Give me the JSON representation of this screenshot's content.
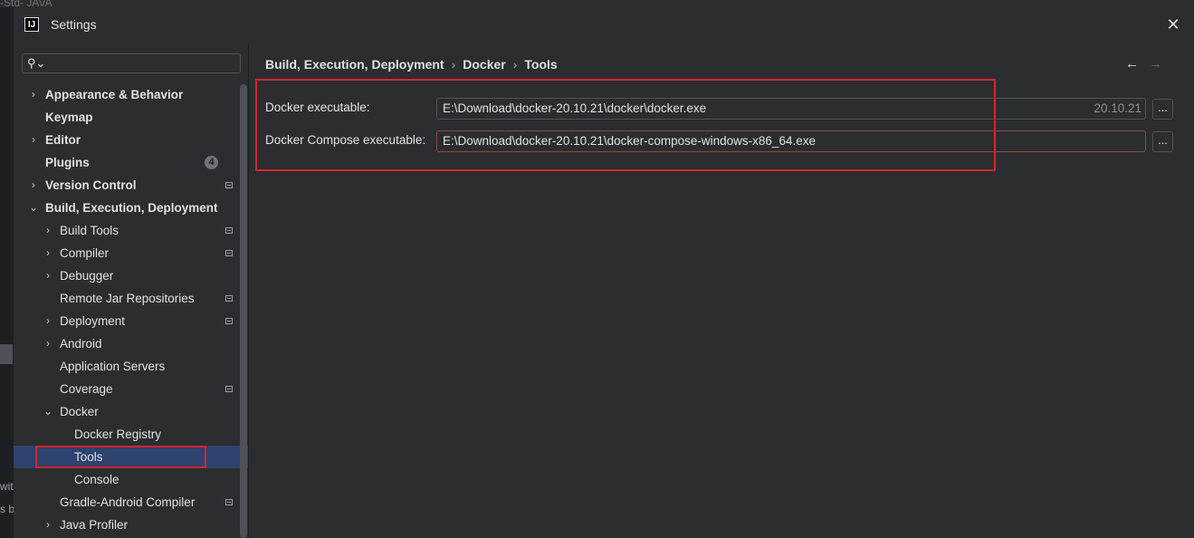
{
  "background": {
    "ide_text": "-Std- JAVA",
    "left_text_1": "wit",
    "left_text_2": "s b"
  },
  "dialog": {
    "title": "Settings",
    "app_icon": "IJ",
    "close_icon": "close-icon"
  },
  "sidebar": {
    "search_placeholder": "",
    "items": [
      {
        "label": "Appearance & Behavior",
        "chevron": "›",
        "bold": true,
        "badge": "",
        "mark": false
      },
      {
        "label": "Keymap",
        "chevron": "",
        "bold": true,
        "badge": "",
        "mark": false
      },
      {
        "label": "Editor",
        "chevron": "›",
        "bold": true,
        "badge": "",
        "mark": false
      },
      {
        "label": "Plugins",
        "chevron": "",
        "bold": true,
        "badge": "4",
        "mark": false
      },
      {
        "label": "Version Control",
        "chevron": "›",
        "bold": true,
        "badge": "",
        "mark": true
      },
      {
        "label": "Build, Execution, Deployment",
        "chevron": "⌄",
        "bold": true,
        "badge": "",
        "mark": false
      },
      {
        "label": "Build Tools",
        "chevron": "›",
        "bold": false,
        "badge": "",
        "mark": true
      },
      {
        "label": "Compiler",
        "chevron": "›",
        "bold": false,
        "badge": "",
        "mark": true
      },
      {
        "label": "Debugger",
        "chevron": "›",
        "bold": false,
        "badge": "",
        "mark": false
      },
      {
        "label": "Remote Jar Repositories",
        "chevron": "",
        "bold": false,
        "badge": "",
        "mark": true
      },
      {
        "label": "Deployment",
        "chevron": "›",
        "bold": false,
        "badge": "",
        "mark": true
      },
      {
        "label": "Android",
        "chevron": "›",
        "bold": false,
        "badge": "",
        "mark": false
      },
      {
        "label": "Application Servers",
        "chevron": "",
        "bold": false,
        "badge": "",
        "mark": false
      },
      {
        "label": "Coverage",
        "chevron": "",
        "bold": false,
        "badge": "",
        "mark": true
      },
      {
        "label": "Docker",
        "chevron": "⌄",
        "bold": false,
        "badge": "",
        "mark": false
      },
      {
        "label": "Docker Registry",
        "chevron": "",
        "bold": false,
        "badge": "",
        "mark": false
      },
      {
        "label": "Tools",
        "chevron": "",
        "bold": false,
        "badge": "",
        "mark": false,
        "selected": true
      },
      {
        "label": "Console",
        "chevron": "",
        "bold": false,
        "badge": "",
        "mark": false
      },
      {
        "label": "Gradle-Android Compiler",
        "chevron": "",
        "bold": false,
        "badge": "",
        "mark": true
      },
      {
        "label": "Java Profiler",
        "chevron": "›",
        "bold": false,
        "badge": "",
        "mark": false
      }
    ]
  },
  "breadcrumb": [
    "Build, Execution, Deployment",
    "Docker",
    "Tools"
  ],
  "form": {
    "docker_label": "Docker executable:",
    "docker_value": "E:\\Download\\docker-20.10.21\\docker\\docker.exe",
    "docker_version": "20.10.21",
    "compose_label": "Docker Compose executable:",
    "compose_value": "E:\\Download\\docker-20.10.21\\docker-compose-windows-x86_64.exe",
    "browse_label": "..."
  },
  "nav": {
    "back": "←",
    "forward": "→"
  },
  "colors": {
    "highlight": "#d7252c",
    "selected": "#2e436e",
    "background": "#2b2d30"
  }
}
